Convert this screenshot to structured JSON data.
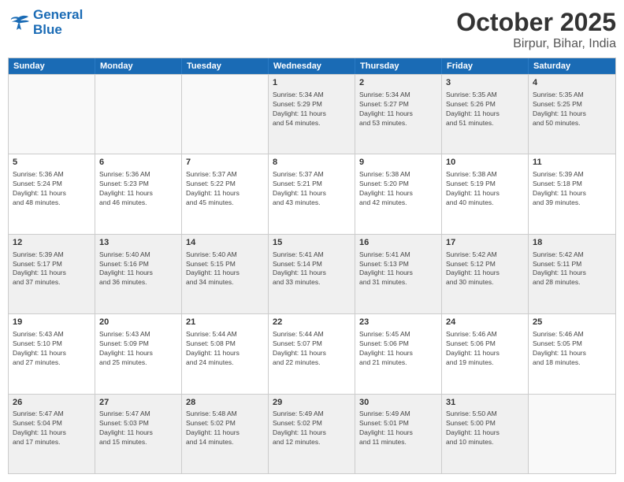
{
  "header": {
    "logo_line1": "General",
    "logo_line2": "Blue",
    "month": "October 2025",
    "location": "Birpur, Bihar, India"
  },
  "weekdays": [
    "Sunday",
    "Monday",
    "Tuesday",
    "Wednesday",
    "Thursday",
    "Friday",
    "Saturday"
  ],
  "rows": [
    [
      {
        "day": "",
        "info": ""
      },
      {
        "day": "",
        "info": ""
      },
      {
        "day": "",
        "info": ""
      },
      {
        "day": "1",
        "info": "Sunrise: 5:34 AM\nSunset: 5:29 PM\nDaylight: 11 hours\nand 54 minutes."
      },
      {
        "day": "2",
        "info": "Sunrise: 5:34 AM\nSunset: 5:27 PM\nDaylight: 11 hours\nand 53 minutes."
      },
      {
        "day": "3",
        "info": "Sunrise: 5:35 AM\nSunset: 5:26 PM\nDaylight: 11 hours\nand 51 minutes."
      },
      {
        "day": "4",
        "info": "Sunrise: 5:35 AM\nSunset: 5:25 PM\nDaylight: 11 hours\nand 50 minutes."
      }
    ],
    [
      {
        "day": "5",
        "info": "Sunrise: 5:36 AM\nSunset: 5:24 PM\nDaylight: 11 hours\nand 48 minutes."
      },
      {
        "day": "6",
        "info": "Sunrise: 5:36 AM\nSunset: 5:23 PM\nDaylight: 11 hours\nand 46 minutes."
      },
      {
        "day": "7",
        "info": "Sunrise: 5:37 AM\nSunset: 5:22 PM\nDaylight: 11 hours\nand 45 minutes."
      },
      {
        "day": "8",
        "info": "Sunrise: 5:37 AM\nSunset: 5:21 PM\nDaylight: 11 hours\nand 43 minutes."
      },
      {
        "day": "9",
        "info": "Sunrise: 5:38 AM\nSunset: 5:20 PM\nDaylight: 11 hours\nand 42 minutes."
      },
      {
        "day": "10",
        "info": "Sunrise: 5:38 AM\nSunset: 5:19 PM\nDaylight: 11 hours\nand 40 minutes."
      },
      {
        "day": "11",
        "info": "Sunrise: 5:39 AM\nSunset: 5:18 PM\nDaylight: 11 hours\nand 39 minutes."
      }
    ],
    [
      {
        "day": "12",
        "info": "Sunrise: 5:39 AM\nSunset: 5:17 PM\nDaylight: 11 hours\nand 37 minutes."
      },
      {
        "day": "13",
        "info": "Sunrise: 5:40 AM\nSunset: 5:16 PM\nDaylight: 11 hours\nand 36 minutes."
      },
      {
        "day": "14",
        "info": "Sunrise: 5:40 AM\nSunset: 5:15 PM\nDaylight: 11 hours\nand 34 minutes."
      },
      {
        "day": "15",
        "info": "Sunrise: 5:41 AM\nSunset: 5:14 PM\nDaylight: 11 hours\nand 33 minutes."
      },
      {
        "day": "16",
        "info": "Sunrise: 5:41 AM\nSunset: 5:13 PM\nDaylight: 11 hours\nand 31 minutes."
      },
      {
        "day": "17",
        "info": "Sunrise: 5:42 AM\nSunset: 5:12 PM\nDaylight: 11 hours\nand 30 minutes."
      },
      {
        "day": "18",
        "info": "Sunrise: 5:42 AM\nSunset: 5:11 PM\nDaylight: 11 hours\nand 28 minutes."
      }
    ],
    [
      {
        "day": "19",
        "info": "Sunrise: 5:43 AM\nSunset: 5:10 PM\nDaylight: 11 hours\nand 27 minutes."
      },
      {
        "day": "20",
        "info": "Sunrise: 5:43 AM\nSunset: 5:09 PM\nDaylight: 11 hours\nand 25 minutes."
      },
      {
        "day": "21",
        "info": "Sunrise: 5:44 AM\nSunset: 5:08 PM\nDaylight: 11 hours\nand 24 minutes."
      },
      {
        "day": "22",
        "info": "Sunrise: 5:44 AM\nSunset: 5:07 PM\nDaylight: 11 hours\nand 22 minutes."
      },
      {
        "day": "23",
        "info": "Sunrise: 5:45 AM\nSunset: 5:06 PM\nDaylight: 11 hours\nand 21 minutes."
      },
      {
        "day": "24",
        "info": "Sunrise: 5:46 AM\nSunset: 5:06 PM\nDaylight: 11 hours\nand 19 minutes."
      },
      {
        "day": "25",
        "info": "Sunrise: 5:46 AM\nSunset: 5:05 PM\nDaylight: 11 hours\nand 18 minutes."
      }
    ],
    [
      {
        "day": "26",
        "info": "Sunrise: 5:47 AM\nSunset: 5:04 PM\nDaylight: 11 hours\nand 17 minutes."
      },
      {
        "day": "27",
        "info": "Sunrise: 5:47 AM\nSunset: 5:03 PM\nDaylight: 11 hours\nand 15 minutes."
      },
      {
        "day": "28",
        "info": "Sunrise: 5:48 AM\nSunset: 5:02 PM\nDaylight: 11 hours\nand 14 minutes."
      },
      {
        "day": "29",
        "info": "Sunrise: 5:49 AM\nSunset: 5:02 PM\nDaylight: 11 hours\nand 12 minutes."
      },
      {
        "day": "30",
        "info": "Sunrise: 5:49 AM\nSunset: 5:01 PM\nDaylight: 11 hours\nand 11 minutes."
      },
      {
        "day": "31",
        "info": "Sunrise: 5:50 AM\nSunset: 5:00 PM\nDaylight: 11 hours\nand 10 minutes."
      },
      {
        "day": "",
        "info": ""
      }
    ]
  ]
}
